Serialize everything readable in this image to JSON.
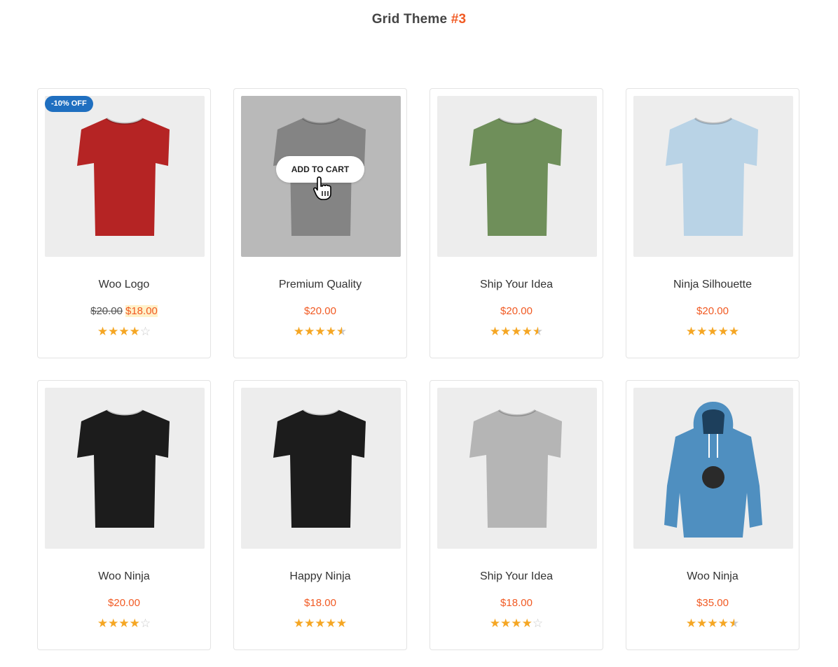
{
  "header": {
    "title": "Grid Theme",
    "title_accent": "#3"
  },
  "colors": {
    "accent": "#f15a23",
    "badge": "#1f6fc0",
    "star": "#f5a623"
  },
  "products": [
    {
      "name": "Woo Logo",
      "old_price": "$20.00",
      "price": "$18.00",
      "rating": 4,
      "badge": "-10% OFF",
      "image": "red-woo-tshirt",
      "shirt_color": "#b52424"
    },
    {
      "name": "Premium Quality",
      "price": "$20.00",
      "rating": 4.5,
      "cart_label": "ADD TO CART",
      "image": "grey-woothemes-tshirt",
      "shirt_color": "#a9a9a9"
    },
    {
      "name": "Ship Your Idea",
      "price": "$20.00",
      "rating": 4.5,
      "image": "green-ship-your-idea-tshirt",
      "shirt_color": "#6f8f5a"
    },
    {
      "name": "Ninja Silhouette",
      "price": "$20.00",
      "rating": 5,
      "image": "lightblue-ninja-tshirt",
      "shirt_color": "#b9d3e6"
    },
    {
      "name": "Woo Ninja",
      "price": "$20.00",
      "rating": 4,
      "image": "black-ship-your-idea-tshirt",
      "shirt_color": "#1c1c1c"
    },
    {
      "name": "Happy Ninja",
      "price": "$18.00",
      "rating": 5,
      "image": "black-happy-ninja-tshirt",
      "shirt_color": "#1c1c1c"
    },
    {
      "name": "Ship Your Idea",
      "price": "$18.00",
      "rating": 4,
      "image": "grey-ninja-tshirt",
      "shirt_color": "#b5b5b5"
    },
    {
      "name": "Woo Ninja",
      "price": "$35.00",
      "rating": 4.5,
      "image": "blue-ship-your-idea-hoodie",
      "shirt_color": "#4f8fc0"
    }
  ]
}
